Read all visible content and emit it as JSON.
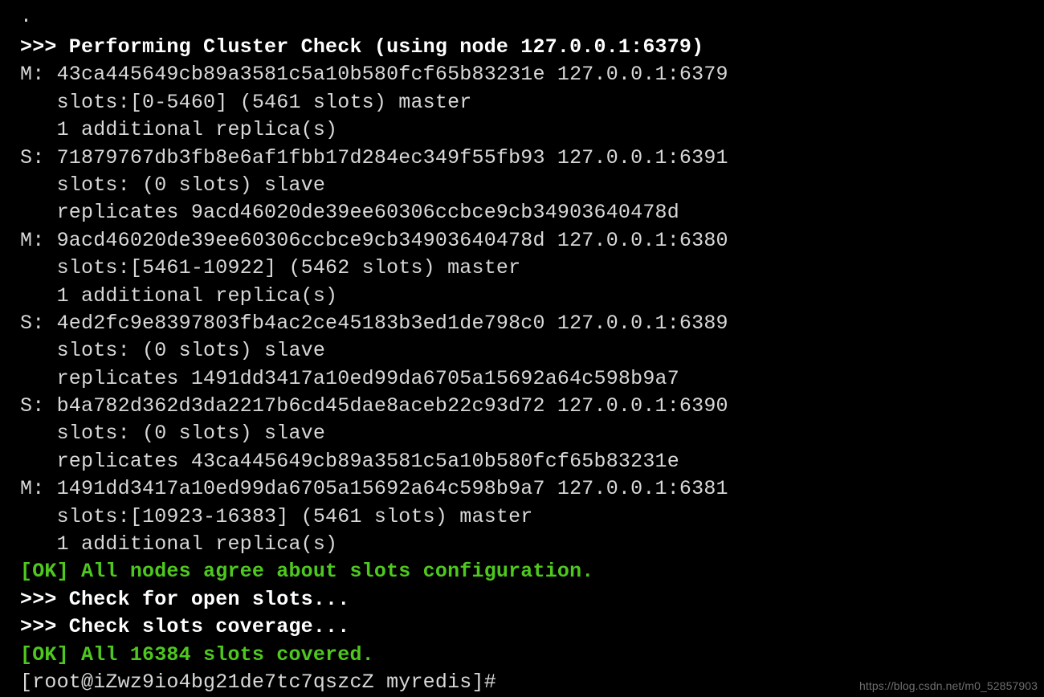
{
  "terminal": {
    "background_color": "#000000",
    "default_text_color": "#d8d8d8",
    "bold_white_color": "#ffffff",
    "success_color": "#4ec81e",
    "lines": [
      {
        "text": ".",
        "style": "plain"
      },
      {
        "text": ">>> Performing Cluster Check (using node 127.0.0.1:6379)",
        "style": "bold-white"
      },
      {
        "text": "M: 43ca445649cb89a3581c5a10b580fcf65b83231e 127.0.0.1:6379",
        "style": "plain"
      },
      {
        "text": "   slots:[0-5460] (5461 slots) master",
        "style": "plain"
      },
      {
        "text": "   1 additional replica(s)",
        "style": "plain"
      },
      {
        "text": "S: 71879767db3fb8e6af1fbb17d284ec349f55fb93 127.0.0.1:6391",
        "style": "plain"
      },
      {
        "text": "   slots: (0 slots) slave",
        "style": "plain"
      },
      {
        "text": "   replicates 9acd46020de39ee60306ccbce9cb34903640478d",
        "style": "plain"
      },
      {
        "text": "M: 9acd46020de39ee60306ccbce9cb34903640478d 127.0.0.1:6380",
        "style": "plain"
      },
      {
        "text": "   slots:[5461-10922] (5462 slots) master",
        "style": "plain"
      },
      {
        "text": "   1 additional replica(s)",
        "style": "plain"
      },
      {
        "text": "S: 4ed2fc9e8397803fb4ac2ce45183b3ed1de798c0 127.0.0.1:6389",
        "style": "plain"
      },
      {
        "text": "   slots: (0 slots) slave",
        "style": "plain"
      },
      {
        "text": "   replicates 1491dd3417a10ed99da6705a15692a64c598b9a7",
        "style": "plain"
      },
      {
        "text": "S: b4a782d362d3da2217b6cd45dae8aceb22c93d72 127.0.0.1:6390",
        "style": "plain"
      },
      {
        "text": "   slots: (0 slots) slave",
        "style": "plain"
      },
      {
        "text": "   replicates 43ca445649cb89a3581c5a10b580fcf65b83231e",
        "style": "plain"
      },
      {
        "text": "M: 1491dd3417a10ed99da6705a15692a64c598b9a7 127.0.0.1:6381",
        "style": "plain"
      },
      {
        "text": "   slots:[10923-16383] (5461 slots) master",
        "style": "plain"
      },
      {
        "text": "   1 additional replica(s)",
        "style": "plain"
      },
      {
        "text": "[OK] All nodes agree about slots configuration.",
        "style": "green"
      },
      {
        "text": ">>> Check for open slots...",
        "style": "bold-white"
      },
      {
        "text": ">>> Check slots coverage...",
        "style": "bold-white"
      },
      {
        "text": "[OK] All 16384 slots covered.",
        "style": "green"
      },
      {
        "text": "[root@iZwz9io4bg21de7tc7qszcZ myredis]#",
        "style": "prompt"
      }
    ]
  },
  "watermark": {
    "text": "https://blog.csdn.net/m0_52857903"
  }
}
